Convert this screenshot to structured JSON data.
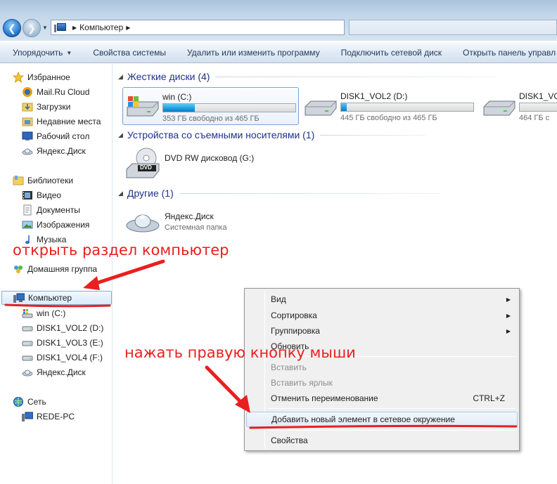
{
  "address": {
    "location": "Компьютер"
  },
  "toolbar": {
    "items": [
      "Упорядочить",
      "Свойства системы",
      "Удалить или изменить программу",
      "Подключить сетевой диск",
      "Открыть панель управл"
    ]
  },
  "navpane": {
    "favorites": {
      "label": "Избранное",
      "items": [
        "Mail.Ru Cloud",
        "Загрузки",
        "Недавние места",
        "Рабочий стол",
        "Яндекс.Диск"
      ]
    },
    "libraries": {
      "label": "Библиотеки",
      "items": [
        "Видео",
        "Документы",
        "Изображения",
        "Музыка"
      ]
    },
    "homegroup": "Домашняя группа",
    "computer": {
      "label": "Компьютер",
      "items": [
        "win (C:)",
        "DISK1_VOL2 (D:)",
        "DISK1_VOL3 (E:)",
        "DISK1_VOL4 (F:)",
        "Яндекс.Диск"
      ]
    },
    "network": {
      "label": "Сеть",
      "items": [
        "REDE-PC"
      ]
    }
  },
  "groups": {
    "hdd": "Жесткие диски (4)",
    "removable": "Устройства со съемными носителями (1)",
    "other": "Другие (1)"
  },
  "drives": [
    {
      "name": "win (C:)",
      "free": "353 ГБ свободно из 465 ГБ",
      "used_fraction": 0.24
    },
    {
      "name": "DISK1_VOL2 (D:)",
      "free": "445 ГБ свободно из 465 ГБ",
      "used_fraction": 0.04
    },
    {
      "name": "DISK1_VO",
      "free": "464 ГБ с"
    }
  ],
  "dvd": {
    "name": "DVD RW дисковод (G:)",
    "badge": "DVD"
  },
  "yandex": {
    "name": "Яндекс.Диск",
    "sub": "Системная папка"
  },
  "context_menu": {
    "view": "Вид",
    "sort": "Сортировка",
    "group": "Группировка",
    "refresh": "Обновить",
    "paste": "Вставить",
    "paste_shortcut": "Вставить ярлык",
    "undo_rename": "Отменить переименование",
    "undo_shortcut": "CTRL+Z",
    "add_network": "Добавить новый элемент в сетевое окружение",
    "properties": "Свойства"
  },
  "annotations": {
    "open_computer": "открыть раздел компьютер",
    "right_click": "нажать правую кнопку мыши"
  },
  "colors": {
    "annotation": "#e8201f",
    "group_header": "#1e3287",
    "bar_fill": "#1b9be0"
  }
}
